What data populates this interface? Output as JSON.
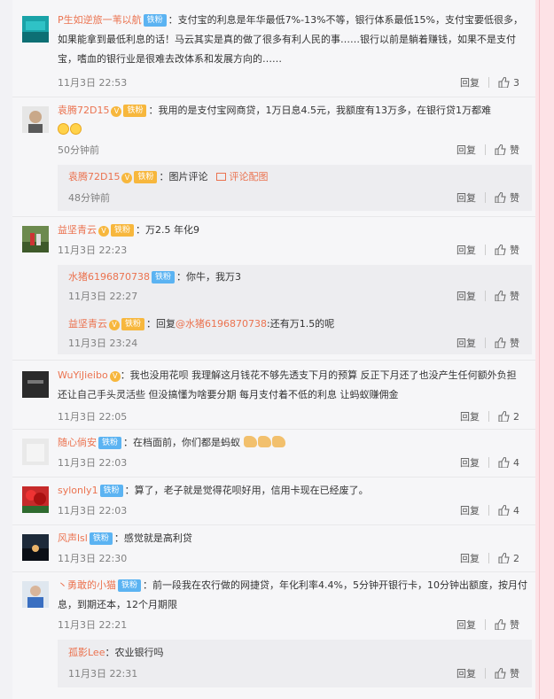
{
  "comments": [
    {
      "name": "P生如逆旅一苇以航",
      "badge": "铁粉",
      "text": "：支付宝的利息是年华最低7%-13%不等，银行体系最低15%，支付宝要低很多，如果能拿到最低利息的话！马云其实是真的做了很多有利人民的事……银行以前是躺着赚钱，如果不是支付宝，嗜血的银行业是很难去改体系和发展方向的……",
      "time": "11月3日 22:53",
      "reply": "回复",
      "likes": "3"
    },
    {
      "name": "袁腾72D15",
      "badge": "铁粉",
      "text": "：我用的是支付宝网商贷，1万日息4.5元，我额度有13万多，在银行贷1万都难",
      "time": "50分钟前",
      "reply": "回复",
      "likes": "赞",
      "sub": {
        "name": "袁腾72D15",
        "badge": "铁粉",
        "text": "：图片评论",
        "link": "评论配图",
        "time": "48分钟前",
        "reply": "回复",
        "likes": "赞"
      }
    },
    {
      "name": "益坚青云",
      "badge": "铁粉",
      "text": "：万2.5 年化9",
      "time": "11月3日 22:23",
      "reply": "回复",
      "likes": "赞",
      "subs": [
        {
          "name": "水猪6196870738",
          "badge": "铁粉",
          "text": "：你牛，我万3",
          "time": "11月3日 22:27",
          "reply": "回复",
          "likes": "赞"
        },
        {
          "name": "益坚青云",
          "badge": "铁粉",
          "text_prefix": "：回复",
          "mention": "@水猪6196870738",
          "text": ":还有万1.5的呢",
          "time": "11月3日 23:24",
          "reply": "回复",
          "likes": "赞"
        }
      ]
    },
    {
      "name": "WuYiJieibo",
      "text": "：我也没用花呗 我理解这月钱花不够先透支下月的预算 反正下月还了也没产生任何额外负担 还让自己手头灵活些 但没搞懂为啥要分期 每月支付着不低的利息 让蚂蚁赚佣金",
      "time": "11月3日 22:05",
      "reply": "回复",
      "likes": "2"
    },
    {
      "name": "随心倘安",
      "badge": "铁粉",
      "text": "：在档面前，你们都是蚂蚁",
      "time": "11月3日 22:03",
      "reply": "回复",
      "likes": "4"
    },
    {
      "name": "sylonly1",
      "badge": "铁粉",
      "text": "：算了，老子就是觉得花呗好用，信用卡现在已经废了。",
      "time": "11月3日 22:03",
      "reply": "回复",
      "likes": "4"
    },
    {
      "name": "风声lsl",
      "badge": "铁粉",
      "text": "：感觉就是高利贷",
      "time": "11月3日 22:30",
      "reply": "回复",
      "likes": "2"
    },
    {
      "name": "丶勇敢的小猫",
      "badge": "铁粉",
      "text": "：前一段我在农行做的网捷贷，年化利率4.4%，5分钟开银行卡，10分钟出额度，按月付息，到期还本，12个月期限",
      "time": "11月3日 22:21",
      "reply": "回复",
      "likes": "赞",
      "sub": {
        "name": "孤影Lee",
        "text": "：农业银行吗",
        "time": "11月3日 22:31",
        "reply": "回复",
        "likes": "赞"
      }
    }
  ]
}
